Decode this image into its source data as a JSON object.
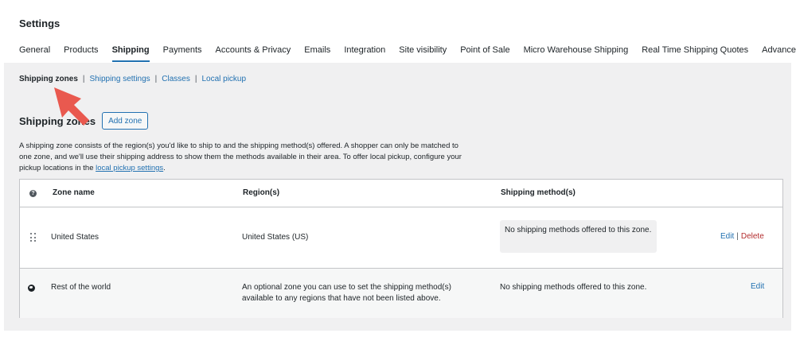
{
  "page": {
    "title": "Settings"
  },
  "tabs": [
    {
      "label": "General"
    },
    {
      "label": "Products"
    },
    {
      "label": "Shipping"
    },
    {
      "label": "Payments"
    },
    {
      "label": "Accounts & Privacy"
    },
    {
      "label": "Emails"
    },
    {
      "label": "Integration"
    },
    {
      "label": "Site visibility"
    },
    {
      "label": "Point of Sale"
    },
    {
      "label": "Micro Warehouse Shipping"
    },
    {
      "label": "Real Time Shipping Quotes"
    },
    {
      "label": "Advanced"
    }
  ],
  "active_tab": "Shipping",
  "subnav": {
    "items": [
      {
        "label": "Shipping zones"
      },
      {
        "label": "Shipping settings"
      },
      {
        "label": "Classes"
      },
      {
        "label": "Local pickup"
      }
    ],
    "separator": "|",
    "current": "Shipping zones"
  },
  "section": {
    "title": "Shipping zones",
    "add_button": "Add zone",
    "description_text": "A shipping zone consists of the region(s) you'd like to ship to and the shipping method(s) offered. A shopper can only be matched to one zone, and we'll use their shipping address to show them the methods available in their area. To offer local pickup, configure your pickup locations in the ",
    "description_link": "local pickup settings",
    "description_end": "."
  },
  "table": {
    "help_icon": "?",
    "headers": {
      "zone_name": "Zone name",
      "regions": "Region(s)",
      "methods": "Shipping method(s)"
    },
    "rows": [
      {
        "zone": "United States",
        "regions": "United States (US)",
        "methods": "No shipping methods offered to this zone.",
        "edit": "Edit",
        "separator": "|",
        "delete": "Delete"
      },
      {
        "zone": "Rest of the world",
        "regions": "An optional zone you can use to set the shipping method(s) available to any regions that have not been listed above.",
        "methods": "No shipping methods offered to this zone.",
        "edit": "Edit"
      }
    ]
  },
  "colors": {
    "accent": "#2271b1",
    "delete": "#b32d2e",
    "content_bg": "#f0f0f1",
    "annotation_arrow": "#e9594f"
  }
}
